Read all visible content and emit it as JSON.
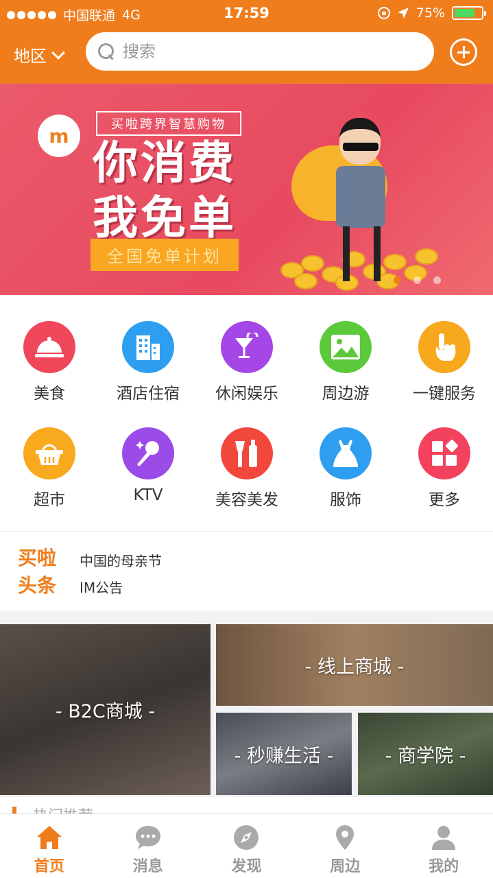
{
  "status_bar": {
    "carrier": "中国联通",
    "network": "4G",
    "time": "17:59",
    "battery": "75%",
    "battery_level": 0.75
  },
  "header": {
    "region_label": "地区",
    "search_placeholder": "搜索"
  },
  "banner": {
    "tagline": "买啦跨界智慧购物",
    "headline_line1": "你消费",
    "headline_line2": "我免单",
    "plan": "全国免单计划",
    "logo_text": "m",
    "slide_count": 3,
    "active_slide": 1
  },
  "categories": [
    {
      "label": "美食",
      "icon": "food-cloche-icon",
      "color": "#f0475b"
    },
    {
      "label": "酒店住宿",
      "icon": "hotel-building-icon",
      "color": "#2e9ff0"
    },
    {
      "label": "休闲娱乐",
      "icon": "cocktail-icon",
      "color": "#a546e6"
    },
    {
      "label": "周边游",
      "icon": "landscape-icon",
      "color": "#5bc93a"
    },
    {
      "label": "一键服务",
      "icon": "hand-pointer-icon",
      "color": "#f8a81c"
    },
    {
      "label": "超市",
      "icon": "basket-icon",
      "color": "#f9a91e"
    },
    {
      "label": "KTV",
      "icon": "microphone-icon",
      "color": "#9b4ce8"
    },
    {
      "label": "美容美发",
      "icon": "cosmetics-icon",
      "color": "#f2473d"
    },
    {
      "label": "服饰",
      "icon": "dress-icon",
      "color": "#2f9ef0"
    },
    {
      "label": "更多",
      "icon": "more-grid-icon",
      "color": "#f2425d"
    }
  ],
  "headlines": {
    "brand_line1": "买啦",
    "brand_line2": "头条",
    "items": [
      "中国的母亲节",
      "IM公告"
    ]
  },
  "mall_tiles": {
    "b2c": "- B2C商城 -",
    "online": "- 线上商城 -",
    "earn": "- 秒赚生活 -",
    "academy": "- 商学院 -"
  },
  "hot_section": {
    "title": "热门推荐"
  },
  "tabbar": [
    {
      "label": "首页",
      "icon": "home-icon",
      "active": true
    },
    {
      "label": "消息",
      "icon": "chat-bubble-icon",
      "active": false
    },
    {
      "label": "发现",
      "icon": "compass-icon",
      "active": false
    },
    {
      "label": "周边",
      "icon": "location-pin-icon",
      "active": false
    },
    {
      "label": "我的",
      "icon": "user-profile-icon",
      "active": false
    }
  ],
  "colors": {
    "brand_orange": "#f07d1c",
    "banner_pink": "#e84a60"
  }
}
